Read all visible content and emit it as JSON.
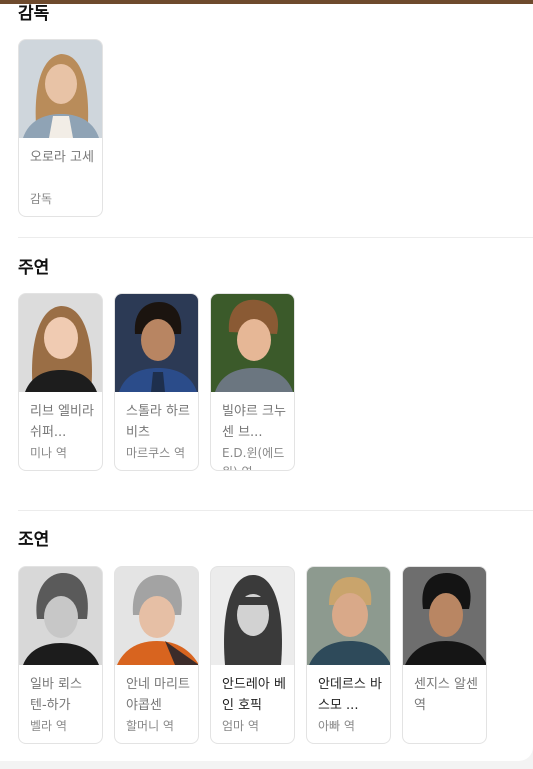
{
  "colors": {
    "top_bar": "#6e4a2d",
    "panel_bg": "#ffffff",
    "page_bg": "#f3f3f3"
  },
  "sections": {
    "director": {
      "title": "감독",
      "people": [
        {
          "name": "오로라 고세",
          "role": "감독",
          "photo": "director-photo"
        }
      ]
    },
    "main_cast": {
      "title": "주연",
      "people": [
        {
          "name": "리브 엘비라 쉬퍼...",
          "role": "미나 역",
          "photo": "girl-photo"
        },
        {
          "name": "스톨라 하르비츠",
          "role": "마르쿠스 역",
          "photo": "boy-photo"
        },
        {
          "name": "빌야르 크누센 브...",
          "role": "E.D.윈(에드윈) 역",
          "photo": "boy-photo"
        }
      ]
    },
    "supporting_cast": {
      "title": "조연",
      "people": [
        {
          "name": "일바 뢰스텐-하가",
          "role": "벨라 역",
          "photo": "woman-bw-photo"
        },
        {
          "name": "안네 마리트 야콥센",
          "role": "할머니 역",
          "photo": "grandmother-photo"
        },
        {
          "name": "안드레아 베인 호픽",
          "role": "엄마 역",
          "photo": "woman-bw-photo"
        },
        {
          "name": "안데르스 바스모 ...",
          "role": "아빠 역",
          "photo": "man-photo"
        },
        {
          "name": "센지스 알센 역",
          "role": "",
          "photo": "man-photo"
        }
      ]
    }
  }
}
